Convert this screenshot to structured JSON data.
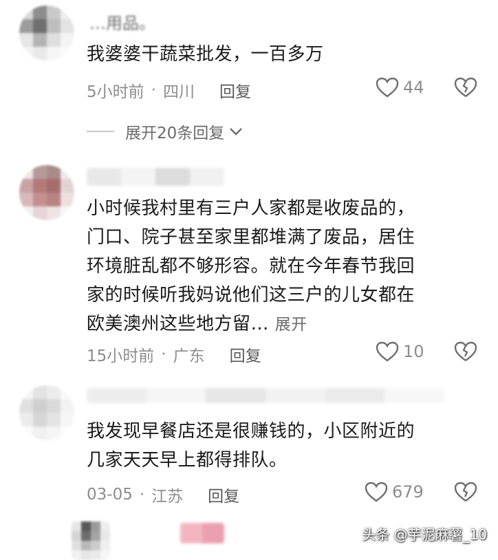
{
  "comments": [
    {
      "text_partial_top": "…用品。",
      "text": "我婆婆干蔬菜批发，一百多万",
      "time": "5小时前",
      "location": "四川",
      "reply_label": "回复",
      "likes": "44",
      "expand_replies": "展开20条回复"
    },
    {
      "lines": [
        "小时候我村里有三户人家都是收废品的，",
        "门口、院子甚至家里都堆满了废品，居住",
        "环境脏乱都不够形容。就在今年春节我回",
        "家的时候听我妈说他们这三户的儿女都在",
        "欧美澳州这些地方留…"
      ],
      "expand_label": "展开",
      "time": "15小时前",
      "location": "广东",
      "reply_label": "回复",
      "likes": "10"
    },
    {
      "lines": [
        "我发现早餐店还是很赚钱的，小区附近的",
        "几家天天早上都得排队。"
      ],
      "time": "03-05",
      "location": "江苏",
      "reply_label": "回复",
      "likes": "679"
    }
  ],
  "watermark": "头条 @芋泥麻薯_10",
  "colors": {
    "meta": "#8c8c8c",
    "text": "#1a1a1a"
  }
}
